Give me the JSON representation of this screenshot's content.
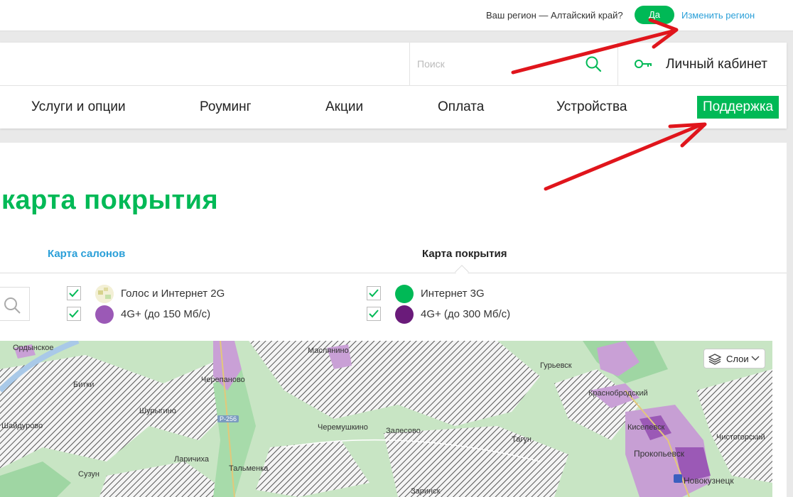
{
  "region_bar": {
    "question": "Ваш регион — Алтайский край?",
    "yes_label": "Да",
    "change_label": "Изменить регион"
  },
  "header": {
    "search_placeholder": "Поиск",
    "cabinet_label": "Личный кабинет",
    "nav": [
      {
        "label": "Услуги и опции"
      },
      {
        "label": "Роуминг"
      },
      {
        "label": "Акции"
      },
      {
        "label": "Оплата"
      },
      {
        "label": "Устройства"
      },
      {
        "label": "Поддержка"
      }
    ]
  },
  "page": {
    "title": "карта покрытия",
    "tabs": [
      {
        "label": "Карта салонов",
        "active": false
      },
      {
        "label": "Карта покрытия",
        "active": true
      }
    ]
  },
  "legend": [
    {
      "label": "Голос и Интернет 2G",
      "checked": true,
      "color": "#e8e0a8"
    },
    {
      "label": "Интернет 3G",
      "checked": true,
      "color": "#00b956"
    },
    {
      "label": "4G+ (до 150 Мб/с)",
      "checked": true,
      "color": "#9b59b6"
    },
    {
      "label": "4G+ (до 300 Мб/с)",
      "checked": true,
      "color": "#6a1b7a"
    }
  ],
  "map": {
    "layers_label": "Слои",
    "road_badge": "P-256",
    "places": [
      "Ордынское",
      "Маслянино",
      "Гурьевск",
      "Черепаново",
      "Битки",
      "Краснобродский",
      "Шурыгино",
      "Шайдурово",
      "Черемушкино",
      "Залесово",
      "Киселевск",
      "Чистогорский",
      "Тагун",
      "Прокопьевск",
      "Сузун",
      "Ларичиха",
      "Тальменка",
      "Новокузнецк",
      "Заринск"
    ]
  },
  "colors": {
    "brand_green": "#00b956",
    "link_blue": "#2a9fd8",
    "annotation_red": "#e0151c"
  }
}
